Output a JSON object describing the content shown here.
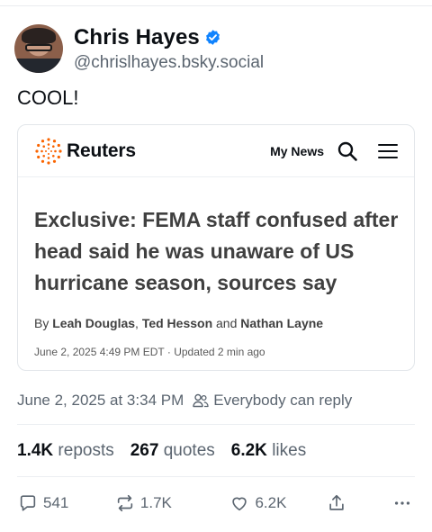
{
  "author": {
    "display_name": "Chris Hayes",
    "handle": "@chrislhayes.bsky.social"
  },
  "post": {
    "text": "COOL!",
    "date": "June 2, 2025 at 3:34 PM",
    "reply_setting": "Everybody can reply"
  },
  "embed": {
    "brand": "Reuters",
    "nav_link": "My News",
    "headline": "Exclusive: FEMA staff confused after head said he was unaware of US hurricane season, sources say",
    "byline_prefix": "By",
    "author1": "Leah Douglas",
    "author2": "Ted Hesson",
    "byline_and": "and",
    "author3": "Nathan Layne",
    "dateline": "June 2, 2025 4:49 PM EDT · Updated 2 min ago"
  },
  "stats": {
    "reposts_count": "1.4K",
    "reposts_label": "reposts",
    "quotes_count": "267",
    "quotes_label": "quotes",
    "likes_count": "6.2K",
    "likes_label": "likes"
  },
  "actions": {
    "replies": "541",
    "reposts": "1.7K",
    "likes": "6.2K"
  },
  "colors": {
    "verified": "#1083fe",
    "reuters_orange": "#fa6400",
    "muted": "#5b6570"
  },
  "icons": [
    "verified-icon",
    "reuters-logo-icon",
    "search-icon",
    "menu-icon",
    "people-icon",
    "reply-icon",
    "repost-icon",
    "like-icon",
    "share-icon",
    "more-icon"
  ]
}
